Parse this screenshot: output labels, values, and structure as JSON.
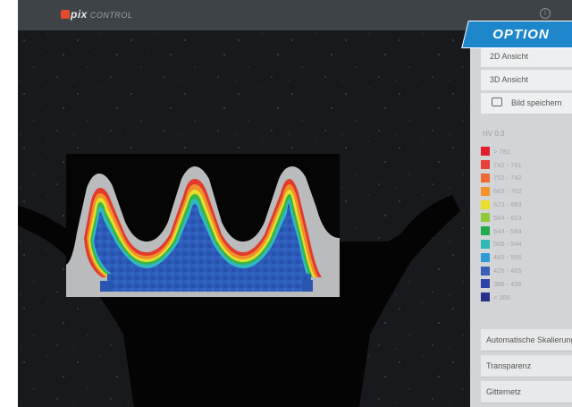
{
  "app": {
    "logo_text": "pix",
    "logo_subtext": "CONTROL",
    "info_glyph": "i"
  },
  "banner": {
    "label": "OPTION"
  },
  "panel": {
    "view_2d": "2D Ansicht",
    "view_3d": "3D Ansicht",
    "save_image": "Bild speichern",
    "hv_label": "HV 0.3",
    "legend": [
      {
        "label": "> 781",
        "color": "#e11f2a"
      },
      {
        "label": "742 - 781",
        "color": "#e8403a"
      },
      {
        "label": "702 - 742",
        "color": "#ee6a33"
      },
      {
        "label": "663 - 702",
        "color": "#f4922b"
      },
      {
        "label": "623 - 663",
        "color": "#ecdf2a"
      },
      {
        "label": "584 - 623",
        "color": "#8fcb36"
      },
      {
        "label": "544 - 584",
        "color": "#1fab4e"
      },
      {
        "label": "505 - 544",
        "color": "#2fb8b4"
      },
      {
        "label": "465 - 505",
        "color": "#2c9bd6"
      },
      {
        "label": "426 - 465",
        "color": "#3a5fb8"
      },
      {
        "label": "386 - 426",
        "color": "#2e43a3"
      },
      {
        "label": "< 386",
        "color": "#283188"
      }
    ],
    "auto_scale": "Automatische Skalierung",
    "transparency": "Transparenz",
    "grid": "Gitternetz"
  },
  "colors": {
    "topbar": "#3e4347",
    "accent": "#1e87cc",
    "logo_mark": "#e34b2f",
    "panel_bg": "#d2d4d6"
  }
}
